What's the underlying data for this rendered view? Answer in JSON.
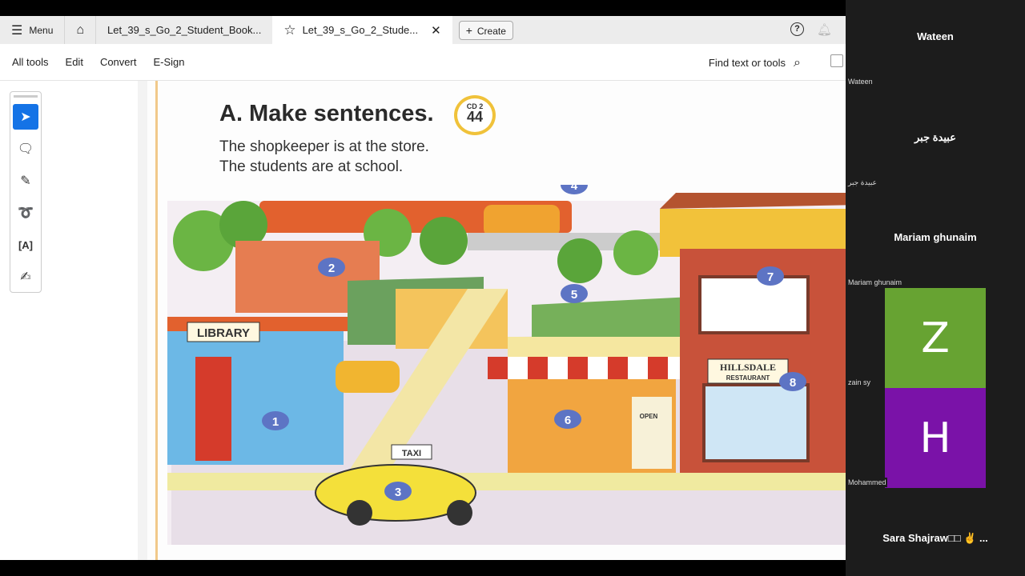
{
  "tabbar": {
    "menu": "Menu",
    "tabs": [
      {
        "label": "Let_39_s_Go_2_Student_Book..."
      },
      {
        "label": "Let_39_s_Go_2_Stude..."
      }
    ],
    "create": "Create"
  },
  "toolbar": {
    "items": [
      "All tools",
      "Edit",
      "Convert",
      "E-Sign"
    ],
    "find": "Find text or tools"
  },
  "page": {
    "heading": "A. Make sentences.",
    "cd_label": "CD 2",
    "cd_track": "44",
    "line1": "The shopkeeper is at the store.",
    "line2": "The students are at school.",
    "library": "LIBRARY",
    "restaurant1": "HILLSDALE",
    "restaurant2": "RESTAURANT",
    "taxi": "TAXI",
    "open": "OPEN",
    "badges": [
      "1",
      "2",
      "3",
      "4",
      "5",
      "6",
      "7",
      "8"
    ]
  },
  "participants": {
    "p1": "Wateen",
    "p1_small": "Wateen",
    "p2": "عبيدة جبر",
    "p2_small": "عبيدة جبر",
    "p3": "Mariam ghunaim",
    "p3_small": "Mariam ghunaim",
    "z_letter": "Z",
    "z_name": "zain sy",
    "h_letter": "H",
    "h_name": "Mohammed",
    "p_last": "Sara  Shajraw□□ ✌ ..."
  },
  "colors": {
    "z": "#67a332",
    "h": "#7a12a8",
    "accent": "#1473e6"
  }
}
